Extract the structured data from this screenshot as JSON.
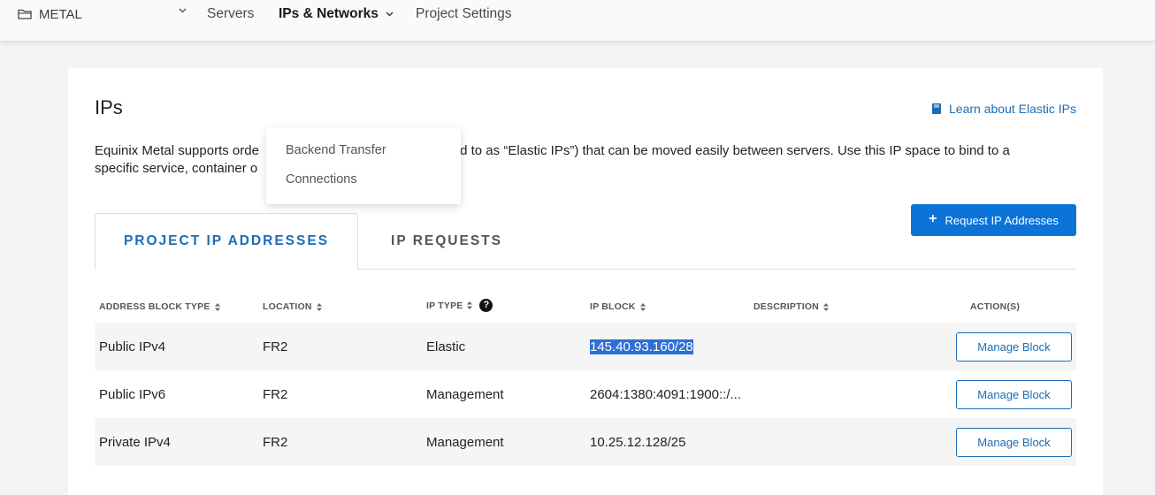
{
  "nav": {
    "project": "METAL",
    "items": [
      "Servers",
      "IPs & Networks",
      "Project Settings"
    ]
  },
  "dropdown": {
    "items": [
      "Backend Transfer",
      "Connections"
    ]
  },
  "page": {
    "title": "IPs",
    "learn_link": "Learn about Elastic IPs",
    "intro_line1_left": "Equinix Metal supports orde",
    "intro_line1_right": "eferred to as “Elastic IPs”) that can be moved easily between servers. Use this IP space to bind to a",
    "intro_line2": "specific service, container o"
  },
  "request_button": "Request IP Addresses",
  "tabs": [
    "PROJECT IP ADDRESSES",
    "IP REQUESTS"
  ],
  "table": {
    "headers": [
      "ADDRESS BLOCK TYPE",
      "LOCATION",
      "IP TYPE",
      "IP BLOCK",
      "DESCRIPTION",
      "ACTION(S)"
    ],
    "rows": [
      {
        "type": "Public IPv4",
        "location": "FR2",
        "ip_type": "Elastic",
        "ip_block": "145.40.93.160/28",
        "description": "",
        "action": "Manage Block"
      },
      {
        "type": "Public IPv6",
        "location": "FR2",
        "ip_type": "Management",
        "ip_block": "2604:1380:4091:1900::/...",
        "description": "",
        "action": "Manage Block"
      },
      {
        "type": "Private IPv4",
        "location": "FR2",
        "ip_type": "Management",
        "ip_block": "10.25.12.128/25",
        "description": "",
        "action": "Manage Block"
      }
    ]
  },
  "colors": {
    "accent": "#1b6db6",
    "button": "#0b73d8",
    "selection": "#2d6fd6"
  }
}
